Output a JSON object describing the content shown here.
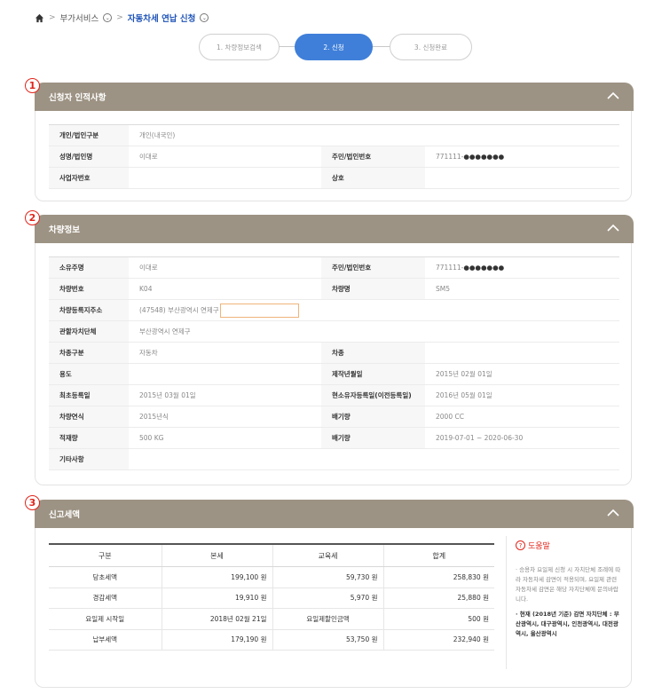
{
  "breadcrumb": {
    "item1": "부가서비스",
    "item2": "자동차세 연납 신청"
  },
  "steps": [
    {
      "label": "1. 차량정보검색"
    },
    {
      "label": "2. 신청"
    },
    {
      "label": "3. 신청완료"
    }
  ],
  "applicant": {
    "badge": "1",
    "title": "신청자 인적사항",
    "type_label": "개인/법인구분",
    "type_value": "개인(내국인)",
    "name_label": "성명/법인명",
    "name_value": "이대로",
    "id_label": "주민/법인번호",
    "id_prefix": "771111-",
    "id_mask": "●●●●●●●",
    "biz_label": "사업자번호",
    "biz_value": "",
    "trade_label": "상호",
    "trade_value": ""
  },
  "vehicle": {
    "badge": "2",
    "title": "차량정보",
    "owner_label": "소유주명",
    "owner_value": "이대로",
    "id_label": "주민/법인번호",
    "id_prefix": "771111-",
    "id_mask": "●●●●●●●",
    "plate_label": "차량번호",
    "plate_value": "K04",
    "model_label": "차량명",
    "model_value": "SM5",
    "addr_label": "차량등록지주소",
    "addr_value": "(47548) 부산광역시 연제구",
    "gov_label": "관할자치단체",
    "gov_value": "부산광역시 연제구",
    "kind_label": "차종구분",
    "kind_value": "자동차",
    "class_label": "차종",
    "class_value": "",
    "use_label": "용도",
    "use_value": "",
    "mfg_label": "제작년월일",
    "mfg_value": "2015년 02월 01일",
    "first_reg_label": "최초등록일",
    "first_reg_value": "2015년 03월 01일",
    "cur_reg_label": "현소유자등록일(이전등록일)",
    "cur_reg_value": "2016년 05월 01일",
    "year_label": "차량연식",
    "year_value": "2015년식",
    "cc_label": "배기량",
    "cc_value": "2000 CC",
    "load_label": "적재량",
    "load_value": "500 KG",
    "period_label": "배기량",
    "period_value": "2019-07-01 ~ 2020-06-30",
    "etc_label": "기타사항",
    "etc_value": ""
  },
  "tax": {
    "badge": "3",
    "title": "신고세액",
    "headers": [
      "구분",
      "본세",
      "교육세",
      "합계"
    ],
    "row1": [
      "당초세액",
      "199,100 원",
      "59,730 원",
      "258,830 원"
    ],
    "row2": [
      "경감세액",
      "19,910 원",
      "5,970 원",
      "25,880 원"
    ],
    "row3": [
      "요일제 시작일",
      "2018년 02월 21일",
      "요일제할인금액",
      "500 원"
    ],
    "row4": [
      "납부세액",
      "179,190 원",
      "53,750 원",
      "232,940 원"
    ]
  },
  "help": {
    "title": "도움말",
    "text": "· 승용차 요일제 신청 시 자치단체 조례에 따라 자동차세 감면이 적용되며, 요일제 관련 자동차세 감면은 해당 자치단체에 문의바랍니다.",
    "bold": "· 현재 (2018년 기준) 감면 자치단체 : 부산광역시, 대구광역시, 인천광역시, 대전광역시, 울산광역시"
  },
  "colors": {
    "panel_header": "#9d9384",
    "step_active": "#3f7fd9",
    "badge_red": "#e1251b",
    "link_blue": "#1f54b8"
  }
}
